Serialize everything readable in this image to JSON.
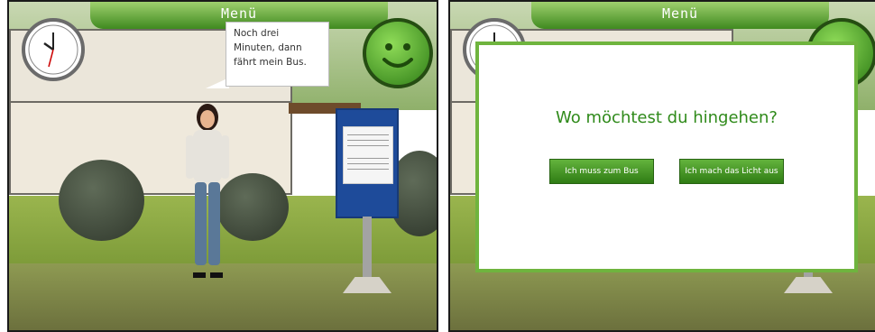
{
  "left_panel": {
    "menu_label": "Menü",
    "speech_bubble": {
      "line1": "Noch drei",
      "line2": "Minuten, dann",
      "line3": "fährt mein Bus."
    }
  },
  "right_panel": {
    "menu_label": "Menü",
    "dialog": {
      "question": "Wo möchtest du hingehen?",
      "option_bus": "Ich muss zum Bus",
      "option_light": "Ich mach das Licht aus"
    }
  },
  "icons": [
    "clock-icon",
    "smiley-icon"
  ],
  "colors": {
    "menu_green": "#3f8a1f",
    "prompt_green": "#2f8a1a",
    "button_green": "#2f7c14",
    "bus_sign_blue": "#1e4b9a"
  }
}
